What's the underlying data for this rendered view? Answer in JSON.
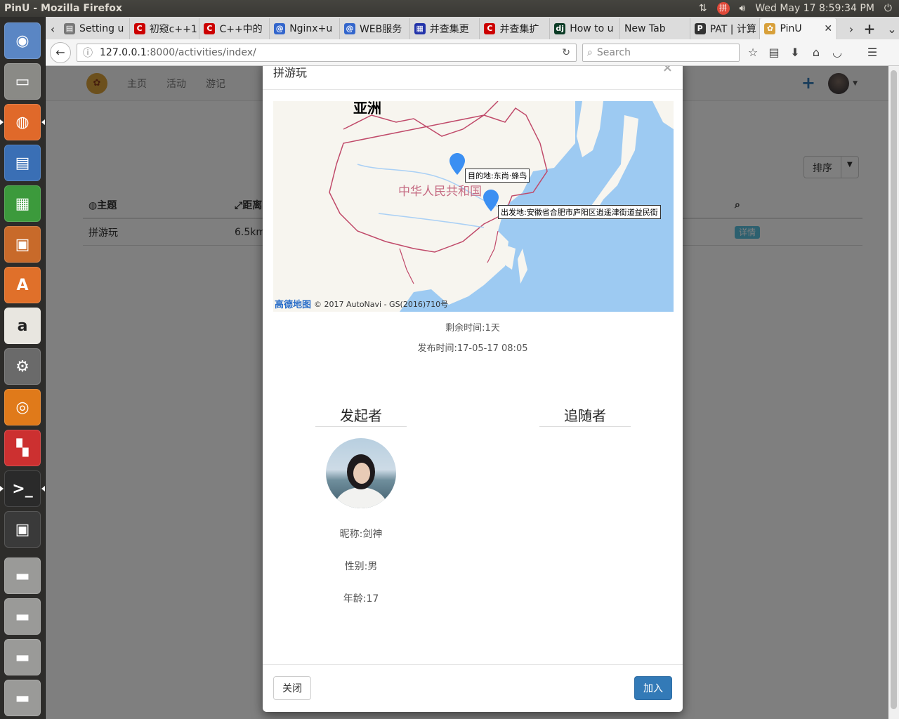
{
  "window": {
    "title": "PinU - Mozilla Firefox"
  },
  "indicators": {
    "ime": "拼",
    "datetime": "Wed May 17  8:59:34 PM"
  },
  "tabs": [
    {
      "label": "Setting u",
      "color": "#777"
    },
    {
      "label": "初窥c++1",
      "color": "#c00"
    },
    {
      "label": "C++中的",
      "color": "#c00"
    },
    {
      "label": "Nginx+u",
      "color": "#3366cc"
    },
    {
      "label": "WEB服务",
      "color": "#3366cc"
    },
    {
      "label": "并查集更",
      "color": "#2233aa"
    },
    {
      "label": "并查集扩",
      "color": "#c00"
    },
    {
      "label": "How to u",
      "color": "#0c3"
    },
    {
      "label": "New Tab",
      "color": ""
    },
    {
      "label": "PAT | 计算",
      "color": "#333"
    },
    {
      "label": "PinU",
      "color": "#d8a03a"
    }
  ],
  "url": {
    "host": "127.0.0.1",
    "path": ":8000/activities/index/"
  },
  "search": {
    "placeholder": "Search"
  },
  "site": {
    "nav": [
      "主页",
      "活动",
      "游记"
    ],
    "sort_label": "排序",
    "table_headers": [
      "主题",
      "距离"
    ],
    "row": {
      "topic": "拼游玩",
      "distance": "6.5km",
      "detail": "详情"
    }
  },
  "modal": {
    "title": "拼游玩",
    "map": {
      "continent_label": "亚洲",
      "country_label": "中华人民共和国",
      "dest_label": "目的地:东尚·蜂鸟",
      "origin_label": "出发地:安徽省合肥市庐阳区逍遥津街道益民街",
      "brand": "高德地图",
      "copyright": "© 2017 AutoNavi - GS(2016)710号"
    },
    "remaining": "剩余时间:1天",
    "published": "发布时间:17-05-17 08:05",
    "initiator_title": "发起者",
    "followers_title": "追随者",
    "nickname": "昵称:剑神",
    "gender": "性别:男",
    "age": "年龄:17",
    "close_label": "关闭",
    "join_label": "加入"
  }
}
